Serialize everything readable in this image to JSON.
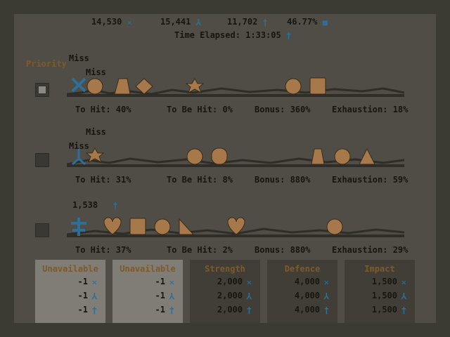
{
  "header": {
    "stats": [
      {
        "value": "14,530",
        "icon": "cross-swords-icon"
      },
      {
        "value": "15,441",
        "icon": "tripod-icon"
      },
      {
        "value": "11,702",
        "icon": "dagger-icon"
      },
      {
        "value": "46.77%",
        "icon": "square-icon"
      }
    ],
    "time_elapsed": "Time Elapsed: 1:33:05"
  },
  "priority_label": "Priority",
  "lanes": [
    {
      "checked": true,
      "miss_labels": [
        "Miss",
        "Miss"
      ],
      "stats": {
        "to_hit": "To Hit: 40%",
        "to_be_hit": "To Be Hit: 0%",
        "bonus": "Bonus: 360%",
        "exhaustion": "Exhaustion: 18%"
      }
    },
    {
      "checked": false,
      "miss_labels": [
        "Miss",
        "Miss"
      ],
      "stats": {
        "to_hit": "To Hit: 31%",
        "to_be_hit": "To Be Hit: 8%",
        "bonus": "Bonus: 880%",
        "exhaustion": "Exhaustion: 59%"
      }
    },
    {
      "checked": false,
      "damage_popup": "1,538",
      "stats": {
        "to_hit": "To Hit: 37%",
        "to_be_hit": "To Be Hit: 2%",
        "bonus": "Bonus: 880%",
        "exhaustion": "Exhaustion: 29%"
      }
    }
  ],
  "panels": [
    {
      "title": "Unavailable",
      "rows": [
        "-1",
        "-1",
        "-1"
      ],
      "style": "light"
    },
    {
      "title": "Unavailable",
      "rows": [
        "-1",
        "-1",
        "-1"
      ],
      "style": "light"
    },
    {
      "title": "Strength",
      "rows": [
        "2,000",
        "2,000",
        "2,000"
      ],
      "style": "dark"
    },
    {
      "title": "Defence",
      "rows": [
        "4,000",
        "4,000",
        "4,000"
      ],
      "style": "dark"
    },
    {
      "title": "Impact",
      "rows": [
        "1,500",
        "1,500",
        "1,500"
      ],
      "style": "dark"
    }
  ],
  "colors": {
    "accent_blue": "#2b6f9a",
    "enemy_orange": "#a7784a",
    "title_orange": "#7c5a2c"
  }
}
